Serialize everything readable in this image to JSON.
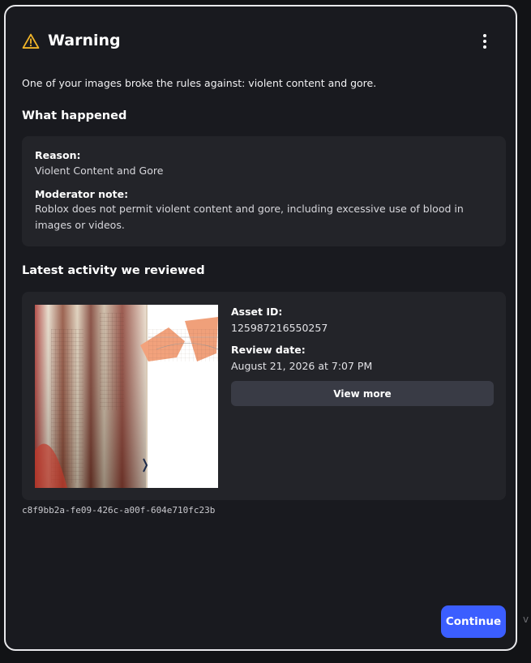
{
  "dialog": {
    "title": "Warning",
    "intro": "One of your images broke the rules against: violent content and gore.",
    "icons": {
      "warning": "warning-triangle-icon",
      "menu": "more-vertical-icon"
    },
    "accent_color": "#f0b429"
  },
  "what_happened": {
    "heading": "What happened",
    "reason_label": "Reason:",
    "reason_value": "Violent Content and Gore",
    "note_label": "Moderator note:",
    "note_value": "Roblox does not permit violent content and gore, including excessive use of blood in images or videos."
  },
  "activity": {
    "heading": "Latest activity we reviewed",
    "asset_id_label": "Asset ID:",
    "asset_id_value": "125987216550257",
    "review_date_label": "Review date:",
    "review_date_value": "August 21, 2026 at 7:07 PM",
    "view_more_label": "View more",
    "reference_id": "c8f9bb2a-fe09-426c-a00f-604e710fc23b"
  },
  "footer": {
    "continue_label": "Continue",
    "continue_color": "#3b5eff"
  }
}
